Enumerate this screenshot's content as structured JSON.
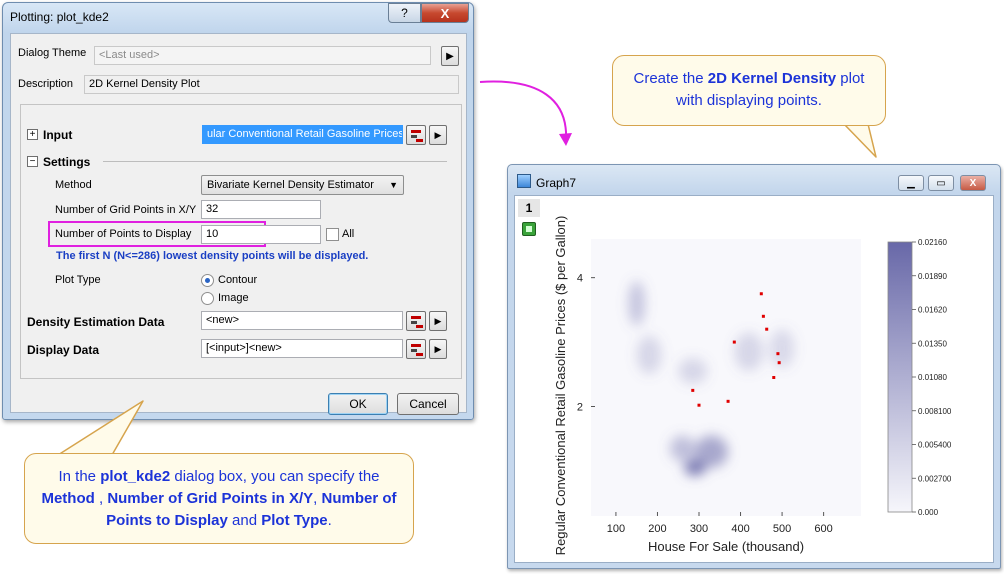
{
  "dialog": {
    "title": "Plotting: plot_kde2",
    "help_label": "?",
    "close_label": "X",
    "theme_label": "Dialog Theme",
    "theme_value": "<Last used>",
    "theme_arrow": "▶",
    "description_label": "Description",
    "description_value": "2D Kernel Density Plot",
    "input_label": "Input",
    "input_value": "ular Conventional Retail Gasoline Prices\"|",
    "settings_label": "Settings",
    "method_label": "Method",
    "method_value": "Bivariate Kernel Density Estimator",
    "grid_points_label": "Number of Grid Points in X/Y",
    "grid_points_value": "32",
    "points_display_label": "Number of Points to Display",
    "points_display_value": "10",
    "all_label": "All",
    "note": "The first N (N<=286) lowest density points will be displayed.",
    "plot_type_label": "Plot Type",
    "plot_type_options": [
      "Contour",
      "Image"
    ],
    "plot_type_selected": "Contour",
    "density_data_label": "Density Estimation Data",
    "density_data_value": "<new>",
    "display_data_label": "Display Data",
    "display_data_value": "[<input>]<new>",
    "ok_label": "OK",
    "cancel_label": "Cancel"
  },
  "callout_dialog": {
    "parts": [
      {
        "text": "In the ",
        "bold": false
      },
      {
        "text": "plot_kde2",
        "bold": true
      },
      {
        "text": " dialog box, you can specify the ",
        "bold": false
      },
      {
        "text": "Method",
        "bold": true
      },
      {
        "text": " , ",
        "bold": false
      },
      {
        "text": "Number of Grid Points in X/Y",
        "bold": true
      },
      {
        "text": ", ",
        "bold": false
      },
      {
        "text": "Number of Points to Display",
        "bold": true
      },
      {
        "text": " and ",
        "bold": false
      },
      {
        "text": "Plot Type",
        "bold": true
      },
      {
        "text": ".",
        "bold": false
      }
    ]
  },
  "callout_graph": {
    "parts": [
      {
        "text": "Create the ",
        "bold": false
      },
      {
        "text": "2D Kernel Density",
        "bold": true
      },
      {
        "text": " plot with displaying points.",
        "bold": false
      }
    ]
  },
  "graph_window": {
    "title": "Graph7",
    "layer_label": "1",
    "minimize_icon": "minimize-icon",
    "restore_icon": "restore-icon",
    "close_label": "X"
  },
  "colors": {
    "accent_blue": "#1c33d8",
    "note_blue": "#1a3fc4",
    "highlight_magenta": "#e020e0",
    "points_red": "#e00000",
    "density_dark": "#6868a8"
  },
  "chart_data": {
    "type": "heatmap",
    "xlabel": "House For Sale (thousand)",
    "ylabel": "Regular Conventional Retail Gasoline Prices ($ per Gallon)",
    "x_ticks": [
      100,
      200,
      300,
      400,
      500,
      600
    ],
    "y_ticks": [
      2,
      4
    ],
    "xlim": [
      40,
      690
    ],
    "ylim": [
      0.3,
      4.6
    ],
    "colorbar": {
      "ticks": [
        "0.02160",
        "0.01890",
        "0.01620",
        "0.01350",
        "0.01080",
        "0.008100",
        "0.005400",
        "0.002700",
        "0.000"
      ],
      "range": [
        0,
        0.0216
      ]
    },
    "density_blobs": [
      {
        "x": 290,
        "y": 1.05,
        "weight": 1.0,
        "sx": 25,
        "sy": 0.12
      },
      {
        "x": 330,
        "y": 1.3,
        "weight": 0.55,
        "sx": 40,
        "sy": 0.25
      },
      {
        "x": 260,
        "y": 1.35,
        "weight": 0.35,
        "sx": 30,
        "sy": 0.2
      },
      {
        "x": 150,
        "y": 3.6,
        "weight": 0.3,
        "sx": 20,
        "sy": 0.35
      },
      {
        "x": 180,
        "y": 2.8,
        "weight": 0.15,
        "sx": 30,
        "sy": 0.3
      },
      {
        "x": 285,
        "y": 2.55,
        "weight": 0.15,
        "sx": 35,
        "sy": 0.2
      },
      {
        "x": 420,
        "y": 2.85,
        "weight": 0.15,
        "sx": 35,
        "sy": 0.3
      },
      {
        "x": 500,
        "y": 2.9,
        "weight": 0.12,
        "sx": 30,
        "sy": 0.3
      }
    ],
    "points": [
      {
        "x": 285,
        "y": 2.25
      },
      {
        "x": 300,
        "y": 2.02
      },
      {
        "x": 370,
        "y": 2.08
      },
      {
        "x": 385,
        "y": 3.0
      },
      {
        "x": 450,
        "y": 3.75
      },
      {
        "x": 455,
        "y": 3.4
      },
      {
        "x": 463,
        "y": 3.2
      },
      {
        "x": 480,
        "y": 2.45
      },
      {
        "x": 490,
        "y": 2.82
      },
      {
        "x": 493,
        "y": 2.68
      }
    ]
  }
}
